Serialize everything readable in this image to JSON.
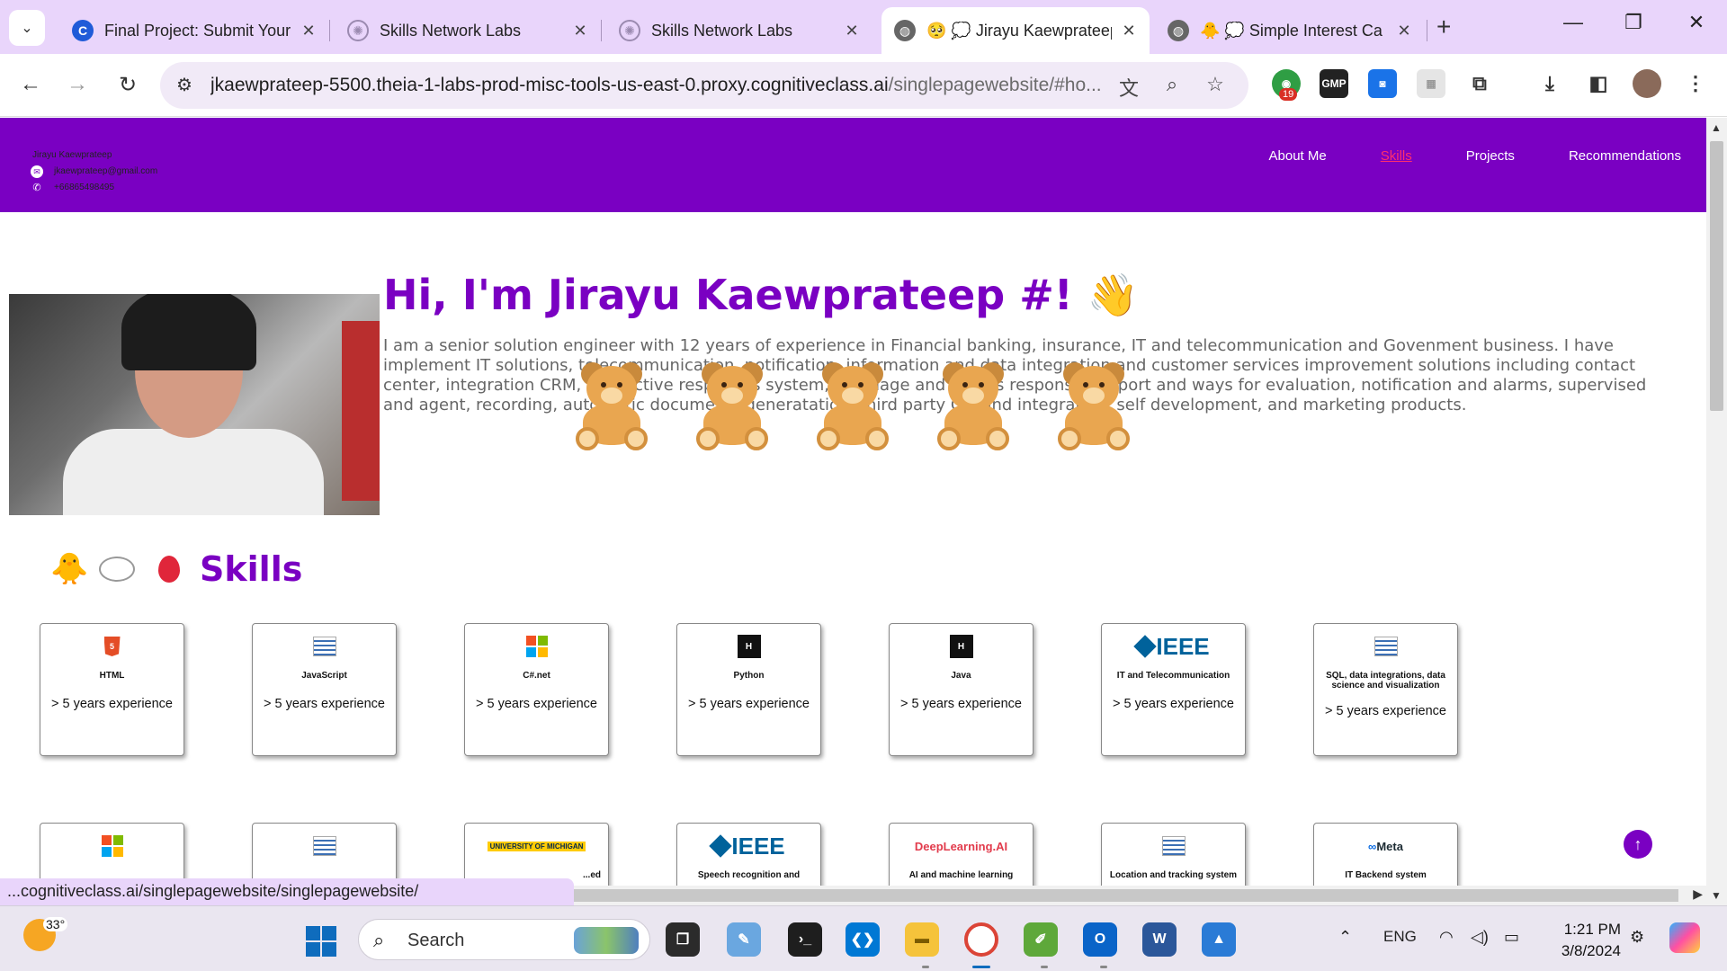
{
  "browser": {
    "tabs": [
      {
        "title": "Final Project: Submit Your",
        "icon": "coursera-icon"
      },
      {
        "title": "Skills Network Labs",
        "icon": "skills-network-icon"
      },
      {
        "title": "Skills Network Labs",
        "icon": "skills-network-icon"
      },
      {
        "title": "🥺 💭 Jirayu Kaewprateep",
        "icon": "globe-icon"
      },
      {
        "title": "🐥 💭 Simple Interest Ca",
        "icon": "globe-icon"
      }
    ],
    "active_tab": 3,
    "url_main": "jkaewprateep-5500.theia-1-labs-prod-misc-tools-us-east-0.proxy.cognitiveclass.ai",
    "url_path": "/singlepagewebsite/#ho...",
    "extension_badge": "19",
    "status_url": "...cognitiveclass.ai/singlepagewebsite/singlepagewebsite/"
  },
  "site": {
    "owner_name": "Jirayu Kaewprateep",
    "email": "jkaewprateep@gmail.com",
    "phone": "+66865498495",
    "nav": [
      {
        "label": "About Me",
        "current": false
      },
      {
        "label": "Skills",
        "current": true
      },
      {
        "label": "Projects",
        "current": false
      },
      {
        "label": "Recommendations",
        "current": false
      }
    ],
    "hero_title": "Hi, I'm Jirayu Kaewprateep #! 👋",
    "hero_text": "I am a senior solution engineer with 12 years of experience in Financial banking, insurance, IT and telecommunication and Govenment business. I have implement IT solutions, telecommunication, notification, information and data integration and customer services improvement solutions including contact center, integration CRM, interactive responses system, language and scripts responses, report and ways for evaluation, notification and alarms, supervised and agent, recording, automatic documents generatation, third party CTI and integration, self development, and marketing products.",
    "skills_title": "Skills",
    "skills_emojis": [
      "🐥",
      "💭",
      "🎈"
    ],
    "skills": [
      {
        "name": "HTML",
        "experience": "> 5 years experience",
        "logo": "html5-logo"
      },
      {
        "name": "JavaScript",
        "experience": "> 5 years experience",
        "logo": "ibm-skills-network-logo"
      },
      {
        "name": "C#.net",
        "experience": "> 5 years experience",
        "logo": "microsoft-logo"
      },
      {
        "name": "Python",
        "experience": "> 5 years experience",
        "logo": "hackerrank-logo"
      },
      {
        "name": "Java",
        "experience": "> 5 years experience",
        "logo": "hackerrank-logo"
      },
      {
        "name": "IT and Telecommunication",
        "experience": "> 5 years experience",
        "logo": "ieee-logo"
      },
      {
        "name": "SQL, data integrations, data science and visualization",
        "experience": "> 5 years experience",
        "logo": "ibm-skills-network-logo"
      }
    ],
    "skills_row2": [
      {
        "name": "",
        "logo": "microsoft-logo"
      },
      {
        "name": "",
        "logo": "ibm-skills-network-logo"
      },
      {
        "name": "...ed",
        "logo": "umich-logo",
        "logo_text": "UNIVERSITY OF MICHIGAN"
      },
      {
        "name": "Speech recognition and",
        "logo": "ieee-logo"
      },
      {
        "name": "AI and machine learning",
        "logo": "deeplearning-ai-logo",
        "logo_text": "DeepLearning.AI"
      },
      {
        "name": "Location and tracking system",
        "logo": "ibm-skills-network-logo"
      },
      {
        "name": "IT Backend system",
        "logo": "meta-logo",
        "logo_text": "Meta"
      }
    ],
    "logo_hr_text": "H",
    "logo_ieee_text": "IEEE",
    "logo_html_text": "5"
  },
  "taskbar": {
    "temperature": "33°",
    "search_label": "Search",
    "language": "ENG",
    "time": "1:21 PM",
    "date": "3/8/2024"
  },
  "colors": {
    "brand_purple": "#7a00c2",
    "nav_current": "#ff2f6d",
    "tab_strip": "#e9d5fb"
  }
}
